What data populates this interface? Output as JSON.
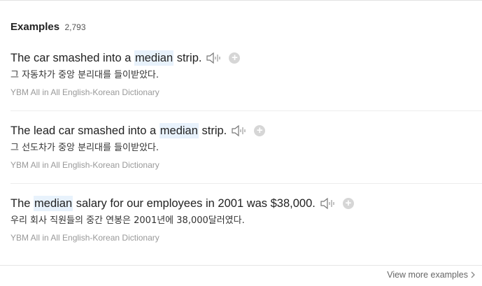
{
  "header": {
    "title": "Examples",
    "count": "2,793"
  },
  "examples": [
    {
      "before": "The car smashed into a ",
      "highlight": "median",
      "after": " strip.",
      "translation": "그 자동차가 중앙 분리대를 들이받았다.",
      "source": "YBM All in All English-Korean Dictionary"
    },
    {
      "before": "The lead car smashed into a ",
      "highlight": "median",
      "after": " strip.",
      "translation": "그 선도차가 중앙 분리대를 들이받았다.",
      "source": "YBM All in All English-Korean Dictionary"
    },
    {
      "before": "The ",
      "highlight": "median",
      "after": " salary for our employees in 2001 was $38,000.",
      "translation": "우리 회사 직원들의 중간 연봉은 2001년에 38,000달러였다.",
      "source": "YBM All in All English-Korean Dictionary"
    }
  ],
  "footer": {
    "more_label": "View more examples"
  },
  "icons": {
    "speaker": "speaker-icon",
    "add": "plus-icon",
    "arrow": "chevron-right-icon"
  },
  "colors": {
    "highlight": "#e8f2fc",
    "source_text": "#999999",
    "add_button": "#d6d6d6"
  }
}
